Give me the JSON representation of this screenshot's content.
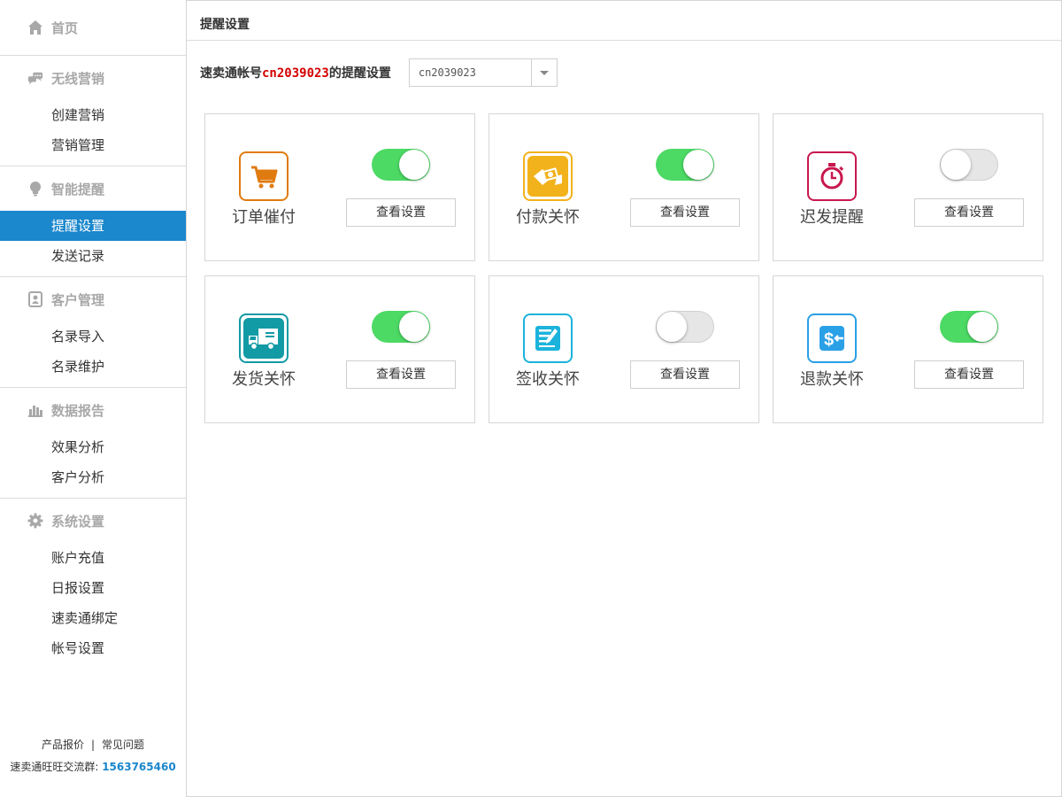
{
  "sidebar": {
    "home": {
      "label": "首页",
      "icon": "home-icon"
    },
    "sections": [
      {
        "label": "无线营销",
        "icon": "chat-icon",
        "items": [
          "创建营销",
          "营销管理"
        ]
      },
      {
        "label": "智能提醒",
        "icon": "bulb-icon",
        "items": [
          "提醒设置",
          "发送记录"
        ],
        "active": "提醒设置"
      },
      {
        "label": "客户管理",
        "icon": "contacts-icon",
        "items": [
          "名录导入",
          "名录维护"
        ]
      },
      {
        "label": "数据报告",
        "icon": "bar-chart-icon",
        "items": [
          "效果分析",
          "客户分析"
        ]
      },
      {
        "label": "系统设置",
        "icon": "gear-icon",
        "items": [
          "账户充值",
          "日报设置",
          "速卖通绑定",
          "帐号设置"
        ]
      }
    ],
    "footer": {
      "link1": "产品报价",
      "separator": "|",
      "link2": "常见问题",
      "group_label": "速卖通旺旺交流群:",
      "group_number": "1563765460"
    }
  },
  "main": {
    "title": "提醒设置",
    "account": {
      "prefix": "速卖通帐号",
      "id": "cn2039023",
      "suffix": "的提醒设置",
      "select_value": "cn2039023"
    },
    "cards": [
      {
        "title": "订单催付",
        "icon": "shopping-cart-icon",
        "color": "#e07b10",
        "enabled": true,
        "button": "查看设置"
      },
      {
        "title": "付款关怀",
        "icon": "money-payment-icon",
        "color": "#f2b21b",
        "enabled": true,
        "button": "查看设置"
      },
      {
        "title": "迟发提醒",
        "icon": "stopwatch-icon",
        "color": "#c8174d",
        "enabled": false,
        "button": "查看设置"
      },
      {
        "title": "发货关怀",
        "icon": "delivery-truck-icon",
        "color": "#129aa5",
        "enabled": true,
        "button": "查看设置"
      },
      {
        "title": "签收关怀",
        "icon": "sign-document-icon",
        "color": "#1bb3dc",
        "enabled": false,
        "button": "查看设置"
      },
      {
        "title": "退款关怀",
        "icon": "refund-dollar-icon",
        "color": "#2aa0e6",
        "enabled": true,
        "button": "查看设置"
      }
    ]
  },
  "colors": {
    "accent": "#1b87cc",
    "toggle_on": "#4cd964",
    "account_id": "#d40000"
  }
}
